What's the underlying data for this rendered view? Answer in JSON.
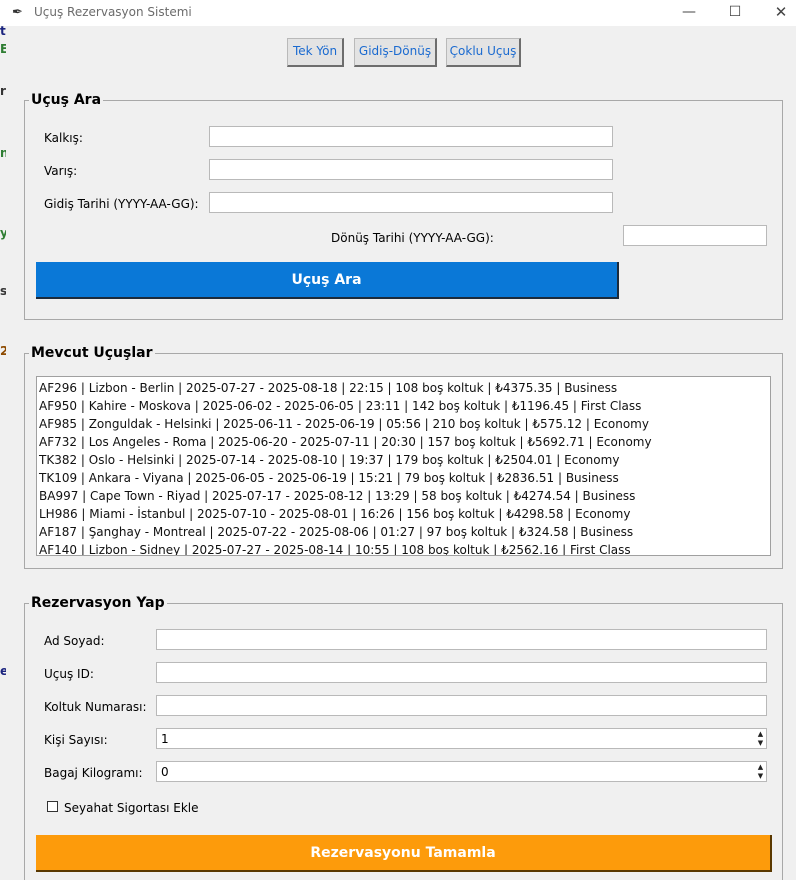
{
  "window": {
    "title": "Uçuş Rezervasyon Sistemi",
    "minimize_glyph": "—",
    "maximize_glyph": "☐",
    "close_glyph": "✕"
  },
  "modes": {
    "one_way": "Tek Yön",
    "round_trip": "Gidiş-Dönüş",
    "multi_city": "Çoklu Uçuş"
  },
  "search": {
    "title": "Uçuş Ara",
    "from_label": "Kalkış:",
    "from_value": "",
    "to_label": "Varış:",
    "to_value": "",
    "depart_label": "Gidiş Tarihi (YYYY-AA-GG):",
    "depart_value": "",
    "return_label": "Dönüş Tarihi (YYYY-AA-GG):",
    "return_value": "",
    "button_label": "Uçuş Ara"
  },
  "flights": {
    "title": "Mevcut Uçuşlar",
    "items": [
      "AF296 | Lizbon - Berlin | 2025-07-27 - 2025-08-18 | 22:15 | 108 boş koltuk | ₺4375.35 | Business",
      "AF950 | Kahire - Moskova | 2025-06-02 - 2025-06-05 | 23:11 | 142 boş koltuk | ₺1196.45 | First Class",
      "AF985 | Zonguldak - Helsinki | 2025-06-11 - 2025-06-19 | 05:56 | 210 boş koltuk | ₺575.12 | Economy",
      "AF732 | Los Angeles - Roma | 2025-06-20 - 2025-07-11 | 20:30 | 157 boş koltuk | ₺5692.71 | Economy",
      "TK382 | Oslo - Helsinki | 2025-07-14 - 2025-08-10 | 19:37 | 179 boş koltuk | ₺2504.01 | Economy",
      "TK109 | Ankara - Viyana | 2025-06-05 - 2025-06-19 | 15:21 | 79 boş koltuk | ₺2836.51 | Business",
      "BA997 | Cape Town - Riyad | 2025-07-17 - 2025-08-12 | 13:29 | 58 boş koltuk | ₺4274.54 | Business",
      "LH986 | Miami - İstanbul | 2025-07-10 - 2025-08-01 | 16:26 | 156 boş koltuk | ₺4298.58 | Economy",
      "AF187 | Şanghay - Montreal | 2025-07-22 - 2025-08-06 | 01:27 | 97 boş koltuk | ₺324.58 | Business",
      "AF140 | Lizbon - Sidney | 2025-07-27 - 2025-08-14 | 10:55 | 108 boş koltuk | ₺2562.16 | First Class"
    ]
  },
  "booking": {
    "title": "Rezervasyon Yap",
    "name_label": "Ad Soyad:",
    "name_value": "",
    "flight_id_label": "Uçuş ID:",
    "flight_id_value": "",
    "seat_label": "Koltuk Numarası:",
    "seat_value": "",
    "people_label": "Kişi Sayısı:",
    "people_value": "1",
    "baggage_label": "Bagaj Kilogramı:",
    "baggage_value": "0",
    "insurance_label": "Seyahat Sigortası Ekle",
    "insurance_checked": false,
    "submit_label": "Rezervasyonu Tamamla"
  },
  "background_fragments": [
    {
      "text": "t",
      "color": "#1a237e"
    },
    {
      "text": "E",
      "color": "#2e7d32"
    },
    {
      "text": "r",
      "color": "#333333"
    },
    {
      "text": "n",
      "color": "#2e7d32"
    },
    {
      "text": "y",
      "color": "#2e7d32"
    },
    {
      "text": "s",
      "color": "#333333"
    },
    {
      "text": "2",
      "color": "#8d4a00"
    },
    {
      "text": "e",
      "color": "#1a237e"
    }
  ],
  "colors": {
    "search_button": "#0a78d7",
    "submit_button": "#fd9b0b",
    "mode_text": "#1a6ad0"
  }
}
